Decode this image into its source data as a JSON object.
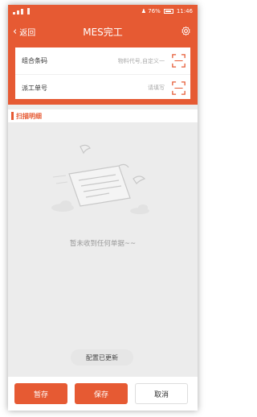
{
  "status_bar": {
    "right_text": "♟ 76%",
    "time": "11:46"
  },
  "navbar": {
    "back_label": "返回",
    "title": "MES完工",
    "accent_color": "#e65a33"
  },
  "form": {
    "fields": [
      {
        "label": "组合条码",
        "placeholder": "物料代号,自定义一"
      },
      {
        "label": "派工单号",
        "placeholder": "请填写"
      }
    ]
  },
  "section": {
    "title": "扫描明细"
  },
  "empty_state": {
    "message": "暂未收到任何单据~~"
  },
  "toast": {
    "text": "配置已更新"
  },
  "actions": {
    "save_draft": "暂存",
    "save": "保存",
    "cancel": "取消"
  }
}
